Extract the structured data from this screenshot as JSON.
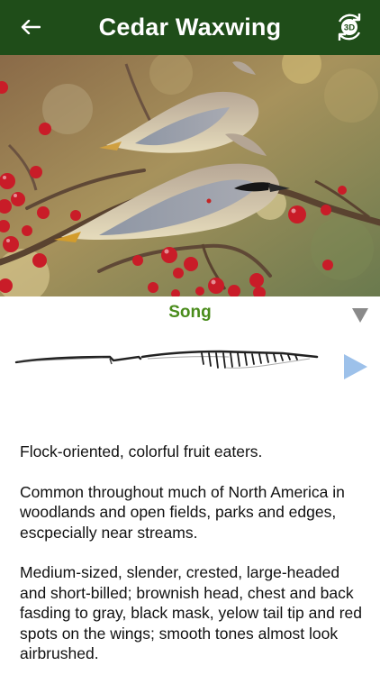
{
  "header": {
    "title": "Cedar Waxwing",
    "three_d_label": "3D"
  },
  "sound": {
    "selected": "Song"
  },
  "description": {
    "paragraphs": [
      "Flock-oriented, colorful fruit eaters.",
      "Common throughout much of North America in woodlands and open fields, parks and edges, escpecially near streams.",
      "Medium-sized, slender, crested, large-headed and short-billed; brownish head, chest and back fasding to gray, black mask, yelow tail tip and red spots on the wings; smooth tones almost look airbrushed."
    ]
  },
  "colors": {
    "header_bg": "#1f4d19",
    "accent_green": "#4a8c1c",
    "play_blue": "#9dc1ea"
  },
  "icons": {
    "back": "back-arrow-icon",
    "three_d": "rotate-3d-icon",
    "dropdown": "triangle-down-icon",
    "play": "play-icon"
  }
}
